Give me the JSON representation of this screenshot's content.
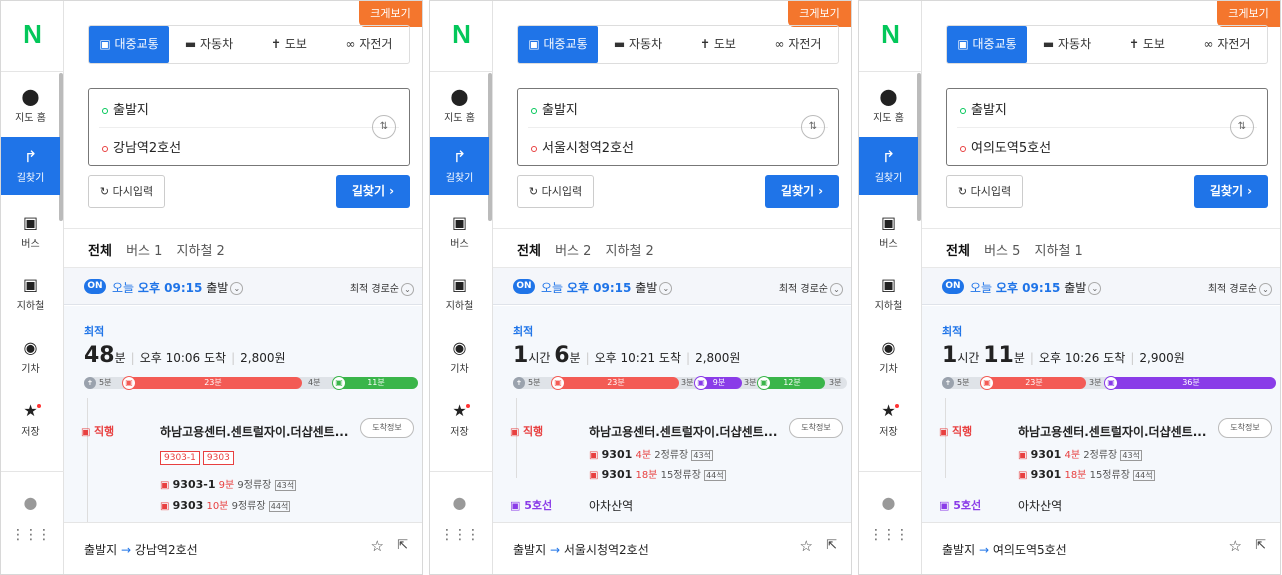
{
  "common": {
    "logo": "N",
    "sidebar": [
      {
        "label": "지도 홈",
        "icon": "pin-icon"
      },
      {
        "label": "길찾기",
        "icon": "directions-icon"
      },
      {
        "label": "버스",
        "icon": "bus-icon"
      },
      {
        "label": "지하철",
        "icon": "subway-icon"
      },
      {
        "label": "기차",
        "icon": "train-icon"
      },
      {
        "label": "저장",
        "icon": "star-icon"
      }
    ],
    "big_view": "크게보기",
    "modes": [
      "대중교통",
      "자동차",
      "도보",
      "자전거"
    ],
    "origin": "출발지",
    "reset": "다시입력",
    "search": "길찾기",
    "all_tab": "전체",
    "on": "ON",
    "time_today": "오늘",
    "time_value": "오후 09:15",
    "time_depart": "출발",
    "sort": "최적 경로순",
    "best": "최적",
    "direct": "직행",
    "arrive_info": "도착정보",
    "stop_name": "하남고용센터.센트럴자이.더샵센트...",
    "footer_origin": "출발지",
    "footer_arrow": "→",
    "accent": "#1f74e8"
  },
  "panels": [
    {
      "destination": "강남역2호선",
      "tab_bus": "버스 1",
      "tab_subway": "지하철 2",
      "dur_h": "",
      "dur_h_unit": "",
      "dur_m": "48",
      "dur_m_unit": "분",
      "arrival": "오후 10:06 도착",
      "fare": "2,800원",
      "timeline": {
        "walk1": "5분",
        "seg1": "23분",
        "gap": "4분",
        "seg2": "11분"
      },
      "chips": [
        "9303-1",
        "9303"
      ],
      "buses": [
        {
          "no": "9303-1",
          "min": "9분",
          "stops": "9정류장",
          "seats": "43석"
        },
        {
          "no": "9303",
          "min": "10분",
          "stops": "9정류장",
          "seats": "44석"
        }
      ]
    },
    {
      "destination": "서울시청역2호선",
      "tab_bus": "버스 2",
      "tab_subway": "지하철 2",
      "dur_h": "1",
      "dur_h_unit": "시간",
      "dur_m": "6",
      "dur_m_unit": "분",
      "arrival": "오후 10:21 도착",
      "fare": "2,800원",
      "timeline": {
        "walk1": "5분",
        "seg1": "23분",
        "gap1": "3분",
        "seg2": "9분",
        "gap2": "3분",
        "seg3": "12분",
        "gap3": "3분"
      },
      "buses": [
        {
          "no": "9301",
          "min": "4분",
          "stops": "2정류장",
          "seats": "43석"
        },
        {
          "no": "9301",
          "min": "18분",
          "stops": "15정류장",
          "seats": "44석"
        }
      ],
      "line": "5호선",
      "line_stop": "아차산역"
    },
    {
      "destination": "여의도역5호선",
      "tab_bus": "버스 5",
      "tab_subway": "지하철 1",
      "dur_h": "1",
      "dur_h_unit": "시간",
      "dur_m": "11",
      "dur_m_unit": "분",
      "arrival": "오후 10:26 도착",
      "fare": "2,900원",
      "timeline": {
        "walk1": "5분",
        "seg1": "23분",
        "gap1": "3분",
        "seg2": "36분"
      },
      "buses": [
        {
          "no": "9301",
          "min": "4분",
          "stops": "2정류장",
          "seats": "43석"
        },
        {
          "no": "9301",
          "min": "18분",
          "stops": "15정류장",
          "seats": "44석"
        }
      ],
      "line": "5호선",
      "line_stop": "아차산역"
    }
  ]
}
